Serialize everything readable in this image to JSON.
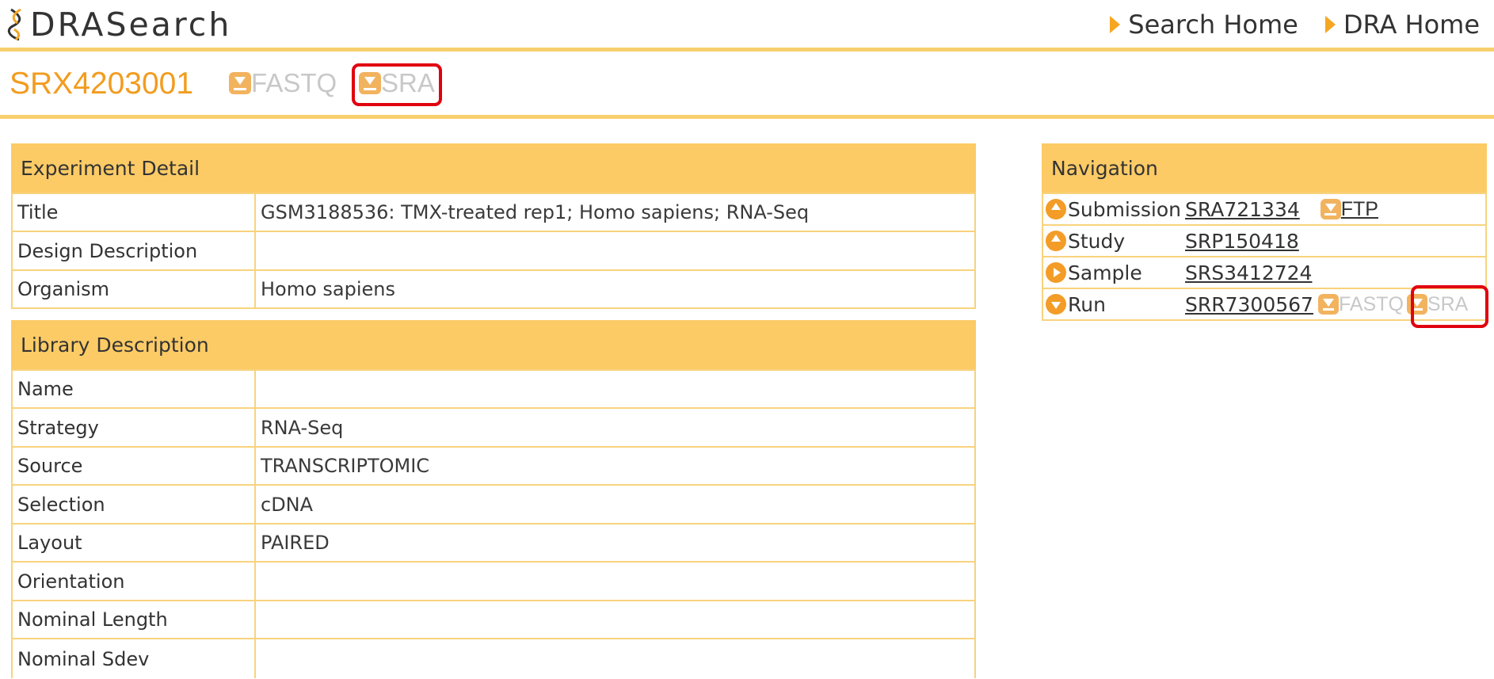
{
  "header": {
    "logo": "DRASearch",
    "links": [
      "Search Home",
      "DRA Home"
    ]
  },
  "experiment": {
    "id": "SRX4203001",
    "downloads": [
      "FASTQ",
      "SRA"
    ]
  },
  "experiment_detail": {
    "title": "Experiment Detail",
    "rows": [
      {
        "key": "Title",
        "value": "GSM3188536: TMX-treated rep1; Homo sapiens; RNA-Seq"
      },
      {
        "key": "Design Description",
        "value": ""
      },
      {
        "key": "Organism",
        "value": "Homo sapiens"
      }
    ]
  },
  "library_description": {
    "title": "Library Description",
    "rows": [
      {
        "key": "Name",
        "value": ""
      },
      {
        "key": "Strategy",
        "value": "RNA-Seq"
      },
      {
        "key": "Source",
        "value": "TRANSCRIPTOMIC"
      },
      {
        "key": "Selection",
        "value": "cDNA"
      },
      {
        "key": "Layout",
        "value": "PAIRED"
      },
      {
        "key": "Orientation",
        "value": ""
      },
      {
        "key": "Nominal Length",
        "value": ""
      },
      {
        "key": "Nominal Sdev",
        "value": ""
      }
    ]
  },
  "navigation": {
    "title": "Navigation",
    "rows": [
      {
        "label": "Submission",
        "link": "SRA721334",
        "extra": "FTP"
      },
      {
        "label": "Study",
        "link": "SRP150418"
      },
      {
        "label": "Sample",
        "link": "SRS3412724"
      },
      {
        "label": "Run",
        "link": "SRR7300567",
        "extra1": "FASTQ",
        "extra2": "SRA"
      }
    ]
  }
}
